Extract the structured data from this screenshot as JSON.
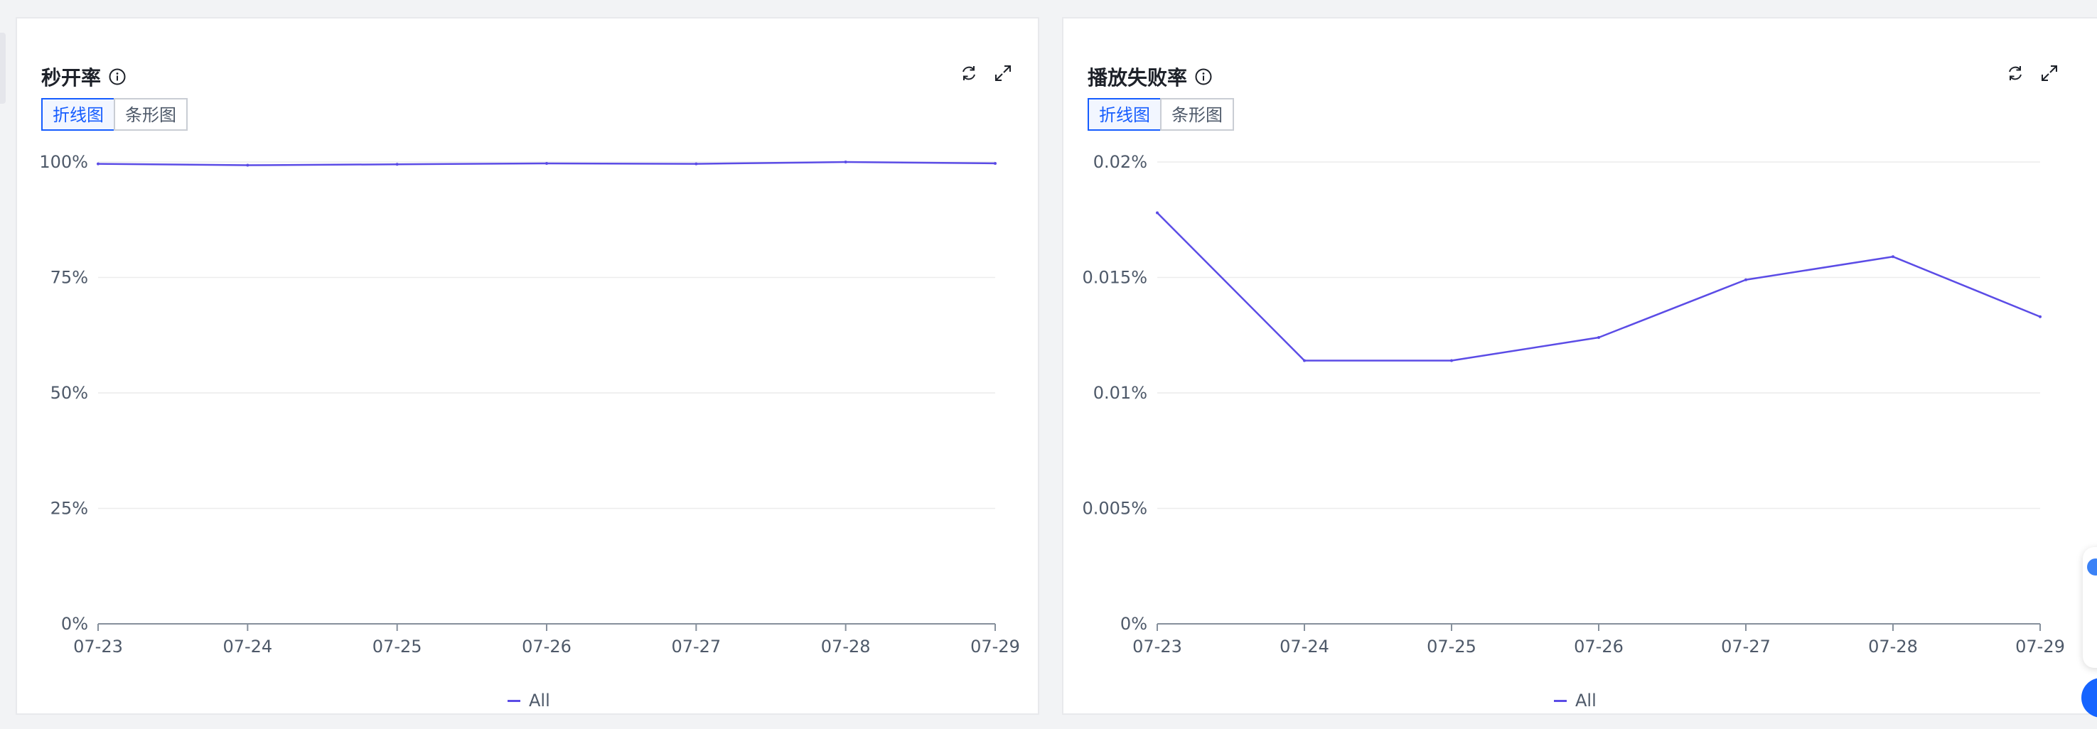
{
  "segment_labels": {
    "line": "折线图",
    "bar": "条形图"
  },
  "colors": {
    "series": "#5b4ce6",
    "accent": "#165dff",
    "grid": "#ececec",
    "axis": "#86909c"
  },
  "panels": [
    {
      "title": "秒开率",
      "active_view": "line",
      "icons": [
        "info-icon",
        "refresh-icon",
        "expand-icon"
      ],
      "chart_data": {
        "type": "line",
        "x": [
          "07-23",
          "07-24",
          "07-25",
          "07-26",
          "07-27",
          "07-28",
          "07-29"
        ],
        "y_ticks": [
          "0%",
          "25%",
          "50%",
          "75%",
          "100%"
        ],
        "ylim": [
          0,
          100
        ],
        "grid": true,
        "legend_position": "bottom-center",
        "series": [
          {
            "name": "All",
            "values": [
              99.6,
              99.3,
              99.5,
              99.7,
              99.6,
              100.0,
              99.7
            ]
          }
        ]
      }
    },
    {
      "title": "播放失败率",
      "active_view": "line",
      "icons": [
        "info-icon",
        "refresh-icon",
        "expand-icon"
      ],
      "chart_data": {
        "type": "line",
        "x": [
          "07-23",
          "07-24",
          "07-25",
          "07-26",
          "07-27",
          "07-28",
          "07-29"
        ],
        "y_ticks": [
          "0%",
          "0.005%",
          "0.01%",
          "0.015%",
          "0.02%"
        ],
        "ylim": [
          0,
          0.02
        ],
        "grid": true,
        "legend_position": "bottom-center",
        "series": [
          {
            "name": "All",
            "values": [
              0.0178,
              0.0114,
              0.0114,
              0.0124,
              0.0149,
              0.0159,
              0.0133
            ]
          }
        ]
      }
    }
  ]
}
